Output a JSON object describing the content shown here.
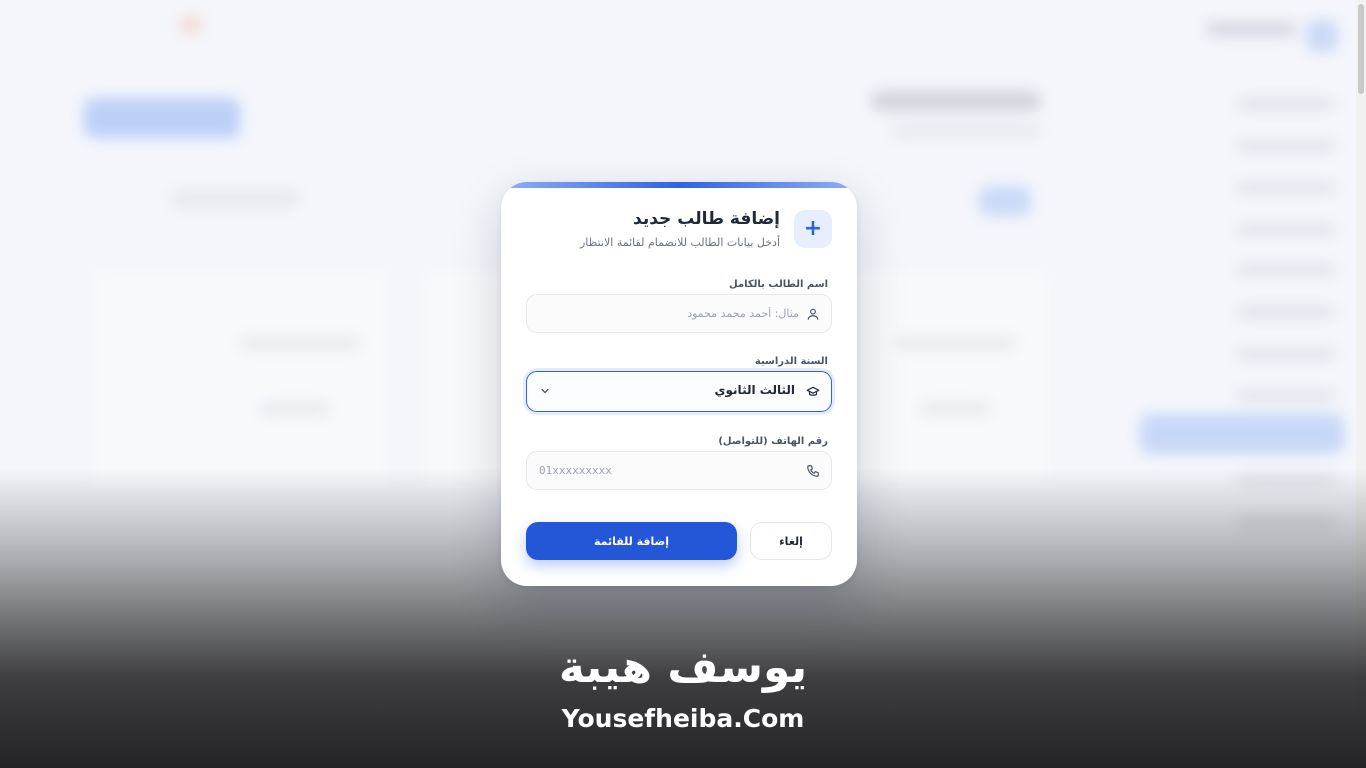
{
  "modal": {
    "title": "إضافة طالب جديد",
    "subtitle": "أدخل بيانات الطالب للانضمام لقائمة الانتظار",
    "add_icon_glyph": "+",
    "name_field": {
      "label": "اسم الطالب بالكامل",
      "placeholder": "مثال: أحمد محمد محمود",
      "value": "",
      "icon": "user-icon"
    },
    "year_field": {
      "label": "السنة الدراسية",
      "selected": "الثالث الثانوي",
      "icon": "graduation-cap-icon"
    },
    "phone_field": {
      "label": "رقم الهاتف (للتواصل)",
      "placeholder": "01xxxxxxxxx",
      "value": "",
      "icon": "phone-icon"
    },
    "submit_label": "إضافة للقائمة",
    "cancel_label": "إلغاء"
  },
  "watermark": {
    "arabic": "يوسف هيبة",
    "latin": "Yousefheiba.Com"
  },
  "colors": {
    "accent": "#2456d8",
    "accent_soft": "#e6eeff",
    "text": "#1f2937",
    "muted": "#6b7280"
  }
}
